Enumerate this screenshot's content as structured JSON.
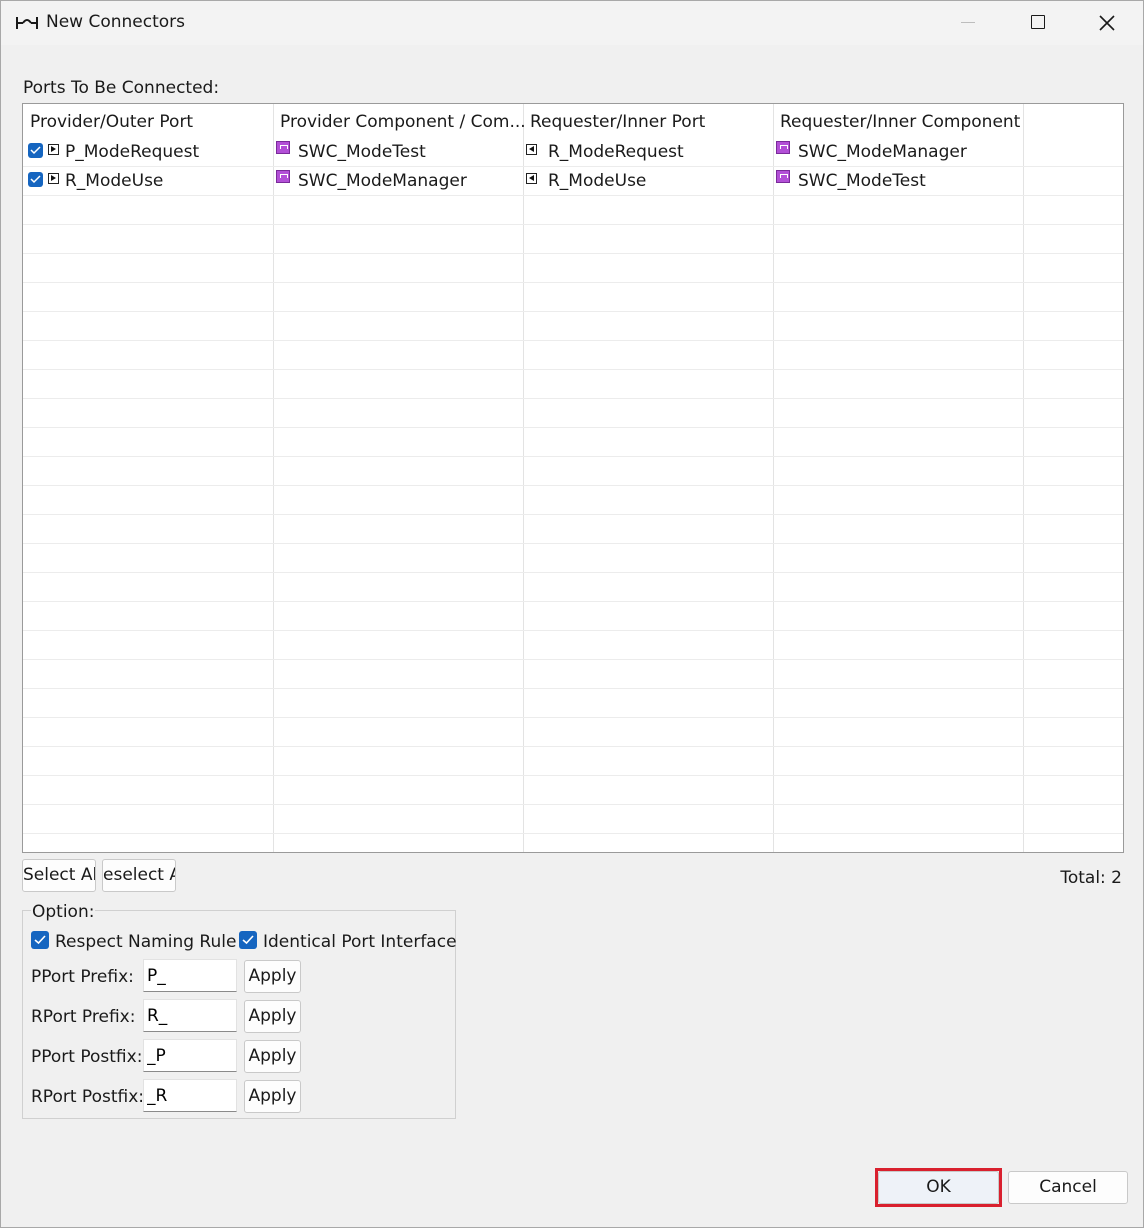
{
  "window": {
    "title": "New Connectors",
    "icon": "connector-icon",
    "controls": [
      "minimize-icon",
      "maximize-icon",
      "close-icon"
    ]
  },
  "table": {
    "caption": "Ports To Be Connected:",
    "columns": [
      "Provider/Outer Port",
      "Provider Component / Com...",
      "Requester/Inner Port",
      "Requester/Inner Component"
    ],
    "rows": [
      {
        "checked": true,
        "provider_port": "P_ModeRequest",
        "provider_component": "SWC_ModeTest",
        "requester_port": "R_ModeRequest",
        "requester_component": "SWC_ModeManager"
      },
      {
        "checked": true,
        "provider_port": "R_ModeUse",
        "provider_component": "SWC_ModeManager",
        "requester_port": "R_ModeUse",
        "requester_component": "SWC_ModeTest"
      }
    ]
  },
  "actions": {
    "select_all": "Select Al",
    "deselect_all": "eselect A",
    "total": "Total: 2"
  },
  "options": {
    "title": "Option:",
    "respect_naming_rule": {
      "label": "Respect Naming Rule",
      "checked": true
    },
    "identical_port_interface": {
      "label": "Identical Port Interface",
      "checked": true
    },
    "fields": [
      {
        "label": "PPort Prefix:",
        "value": "P_",
        "button": "Apply"
      },
      {
        "label": "RPort Prefix:",
        "value": "R_",
        "button": "Apply"
      },
      {
        "label": "PPort Postfix:",
        "value": "_P",
        "button": "Apply"
      },
      {
        "label": "RPort Postfix:",
        "value": "_R",
        "button": "Apply"
      }
    ]
  },
  "footer": {
    "ok": "OK",
    "cancel": "Cancel"
  },
  "colors": {
    "checkbox": "#1565c0",
    "component_icon": "#b24fd6",
    "ok_highlight": "#d9202e"
  }
}
